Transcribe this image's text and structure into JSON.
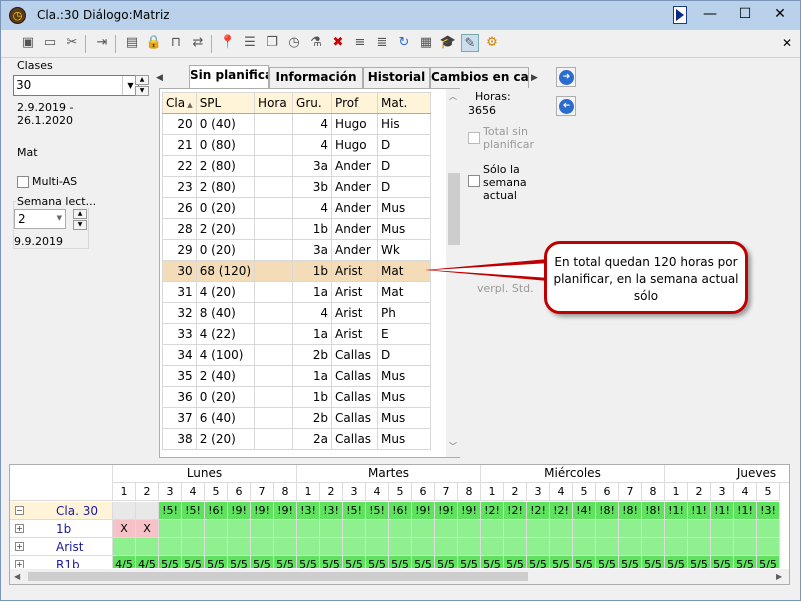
{
  "window": {
    "title": "Cla.:30  Diálogo:Matriz"
  },
  "left": {
    "classes_label": "Clases",
    "class_value": "30",
    "date_range": [
      "2.9.2019 -",
      "26.1.2020"
    ],
    "subject": "Mat",
    "multi_as_label": "Multi-AS",
    "week_label": "Semana lect...",
    "week_value": "2",
    "week_date": "9.9.2019"
  },
  "tabs": [
    {
      "label": "Sin planificar"
    },
    {
      "label": "Información"
    },
    {
      "label": "Historial"
    },
    {
      "label": "Cambios en ca..."
    }
  ],
  "table": {
    "headers": [
      "Cla",
      "SPL",
      "Hora",
      "Gru.",
      "Prof",
      "Mat."
    ],
    "rows": [
      [
        "20",
        "0 (40)",
        "",
        "4",
        "Hugo",
        "His"
      ],
      [
        "21",
        "0 (80)",
        "",
        "4",
        "Hugo",
        "D"
      ],
      [
        "22",
        "2 (80)",
        "",
        "3a",
        "Ander",
        "D"
      ],
      [
        "23",
        "2 (80)",
        "",
        "3b",
        "Ander",
        "D"
      ],
      [
        "26",
        "0 (20)",
        "",
        "4",
        "Ander",
        "Mus"
      ],
      [
        "28",
        "2 (20)",
        "",
        "1b",
        "Ander",
        "Mus"
      ],
      [
        "29",
        "0 (20)",
        "",
        "3a",
        "Ander",
        "Wk"
      ],
      [
        "30",
        "68 (120)",
        "",
        "1b",
        "Arist",
        "Mat"
      ],
      [
        "31",
        "4 (20)",
        "",
        "1a",
        "Arist",
        "Mat"
      ],
      [
        "32",
        "8 (40)",
        "",
        "4",
        "Arist",
        "Ph"
      ],
      [
        "33",
        "4 (22)",
        "",
        "1a",
        "Arist",
        "E"
      ],
      [
        "34",
        "4 (100)",
        "",
        "2b",
        "Callas",
        "D"
      ],
      [
        "35",
        "2 (40)",
        "",
        "1a",
        "Callas",
        "Mus"
      ],
      [
        "36",
        "0 (20)",
        "",
        "1b",
        "Callas",
        "Mus"
      ],
      [
        "37",
        "6 (40)",
        "",
        "2b",
        "Callas",
        "Mus"
      ],
      [
        "38",
        "2 (20)",
        "",
        "2a",
        "Callas",
        "Mus"
      ]
    ],
    "selected_row": 7
  },
  "info": {
    "horas_label": "Horas:",
    "horas_value": "3656",
    "total_sin_label": "Total sin planificar",
    "solo_semana_label": "Sólo la semana actual",
    "verpl_label": "verpl. Std."
  },
  "callout": {
    "text": "En total quedan 120 horas por planificar, en la semana actual sólo"
  },
  "schedule": {
    "days": [
      "Lunes",
      "Martes",
      "Miércoles",
      "Jueves"
    ],
    "rows": [
      {
        "label": "Cla. 30",
        "cells": [
          "",
          "",
          "!5!",
          "!5!",
          "!6!",
          "!9!",
          "!9!",
          "!9!",
          "!3!",
          "!3!",
          "!5!",
          "!5!",
          "!6!",
          "!9!",
          "!9!",
          "!9!",
          "!2!",
          "!2!",
          "!2!",
          "!2!",
          "!4!",
          "!8!",
          "!8!",
          "!8!",
          "!1!",
          "!1!",
          "!1!",
          "!1!",
          "!3!"
        ]
      },
      {
        "label": "1b",
        "cells": [
          "X",
          "X"
        ]
      },
      {
        "label": "Arist",
        "cells": []
      },
      {
        "label": "R1b",
        "cells": [
          "4/5",
          "4/5",
          "5/5",
          "5/5",
          "5/5",
          "5/5",
          "5/5",
          "5/5",
          "5/5",
          "5/5",
          "5/5",
          "5/5",
          "5/5",
          "5/5",
          "5/5",
          "5/5",
          "5/5",
          "5/5",
          "5/5",
          "5/5",
          "5/5",
          "5/5",
          "5/5",
          "5/5",
          "5/5",
          "5/5",
          "5/5",
          "5/5",
          "5/5"
        ]
      }
    ]
  }
}
